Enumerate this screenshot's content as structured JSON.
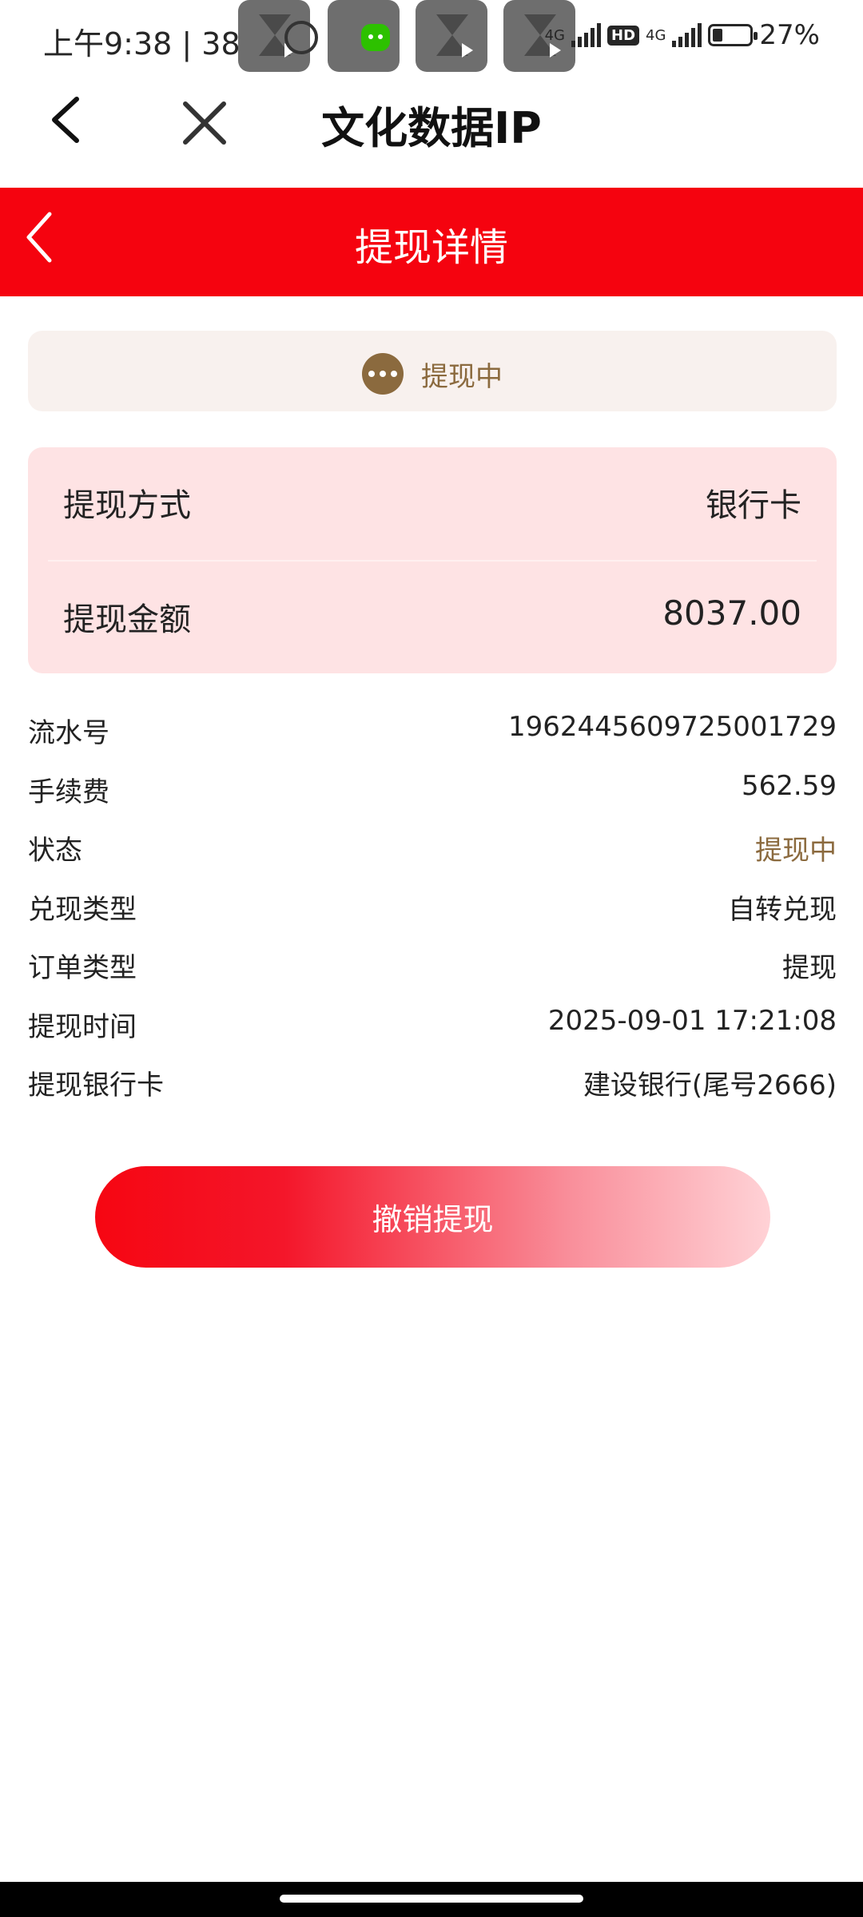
{
  "status_bar": {
    "time_speed": "上午9:38 | 387K/s",
    "network_1": "4G",
    "network_2": "4G",
    "hd": "HD",
    "battery_percent": "27%",
    "battery_level": 0.27,
    "notification_icons": [
      "hourglass-play-icon",
      "wechat-icon",
      "hourglass-play-icon",
      "hd-hourglass-icon"
    ]
  },
  "browser": {
    "title": "文化数据IP"
  },
  "page_header": {
    "title": "提现详情",
    "background": "#f5030f"
  },
  "status_card": {
    "label": "提现中",
    "icon": "more-dots-icon"
  },
  "summary": {
    "method_label": "提现方式",
    "method_value": "银行卡",
    "amount_label": "提现金额",
    "amount_value": "8037.00"
  },
  "details": [
    {
      "label": "流水号",
      "value": "1962445609725001729"
    },
    {
      "label": "手续费",
      "value": "562.59"
    },
    {
      "label": "状态",
      "value": "提现中"
    },
    {
      "label": "兑现类型",
      "value": "自转兑现"
    },
    {
      "label": "订单类型",
      "value": "提现"
    },
    {
      "label": "提现时间",
      "value": "2025-09-01 17:21:08"
    },
    {
      "label": "提现银行卡",
      "value": "建设银行(尾号2666)"
    }
  ],
  "actions": {
    "cancel_label": "撤销提现"
  },
  "colors": {
    "accent_red": "#f5030f",
    "status_gold": "#8b6a3e",
    "card_pink": "#fee3e4"
  }
}
